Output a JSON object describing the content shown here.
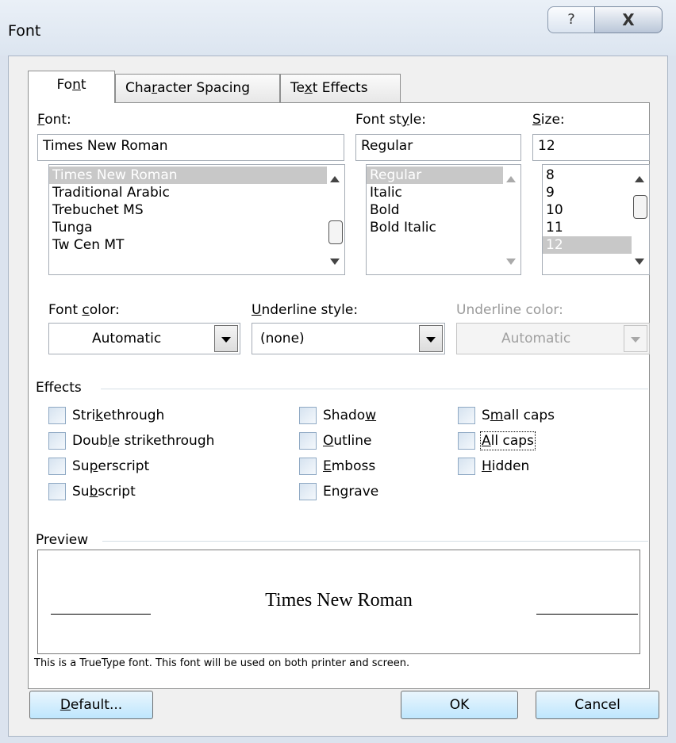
{
  "window": {
    "title": "Font",
    "help_glyph": "?",
    "close_glyph": "X"
  },
  "tabs": [
    {
      "pre": "Fo",
      "key": "n",
      "post": "t"
    },
    {
      "pre": "Cha",
      "key": "r",
      "post": "acter Spacing"
    },
    {
      "pre": "Te",
      "key": "x",
      "post": "t Effects"
    }
  ],
  "font": {
    "label_key": "F",
    "label_rest": "ont:",
    "value": "Times New Roman",
    "list": [
      "Times New Roman",
      "Traditional Arabic",
      "Trebuchet MS",
      "Tunga",
      "Tw Cen MT"
    ]
  },
  "style": {
    "label_pre": "Font st",
    "label_key": "y",
    "label_post": "le:",
    "value": "Regular",
    "list": [
      "Regular",
      "Italic",
      "Bold",
      "Bold Italic"
    ]
  },
  "size": {
    "label_key": "S",
    "label_rest": "ize:",
    "value": "12",
    "list": [
      "8",
      "9",
      "10",
      "11",
      "12"
    ]
  },
  "font_color": {
    "label_pre": "Font ",
    "label_key": "c",
    "label_post": "olor:",
    "value": "Automatic"
  },
  "underline_style": {
    "label_key": "U",
    "label_rest": "nderline style:",
    "value": "(none)"
  },
  "underline_color": {
    "label": "Underline color:",
    "value": "Automatic"
  },
  "effects": {
    "heading": "Effects",
    "items": [
      {
        "pre": "Stri",
        "key": "k",
        "post": "ethrough"
      },
      {
        "pre": "Doub",
        "key": "l",
        "post": "e strikethrough"
      },
      {
        "pre": "Su",
        "key": "p",
        "post": "erscript"
      },
      {
        "pre": "Su",
        "key": "b",
        "post": "script"
      },
      {
        "pre": "Shado",
        "key": "w",
        "post": ""
      },
      {
        "pre": "",
        "key": "O",
        "post": "utline"
      },
      {
        "pre": "",
        "key": "E",
        "post": "mboss"
      },
      {
        "pre": "En",
        "key": "g",
        "post": "rave"
      },
      {
        "pre": "S",
        "key": "m",
        "post": "all caps"
      },
      {
        "pre": "",
        "key": "A",
        "post": "ll caps"
      },
      {
        "pre": "",
        "key": "H",
        "post": "idden"
      }
    ]
  },
  "preview": {
    "heading": "Preview",
    "text": "Times New Roman",
    "note": "This is a TrueType font. This font will be used on both printer and screen."
  },
  "buttons": {
    "default_key": "D",
    "default_rest": "efault...",
    "ok": "OK",
    "cancel": "Cancel"
  }
}
